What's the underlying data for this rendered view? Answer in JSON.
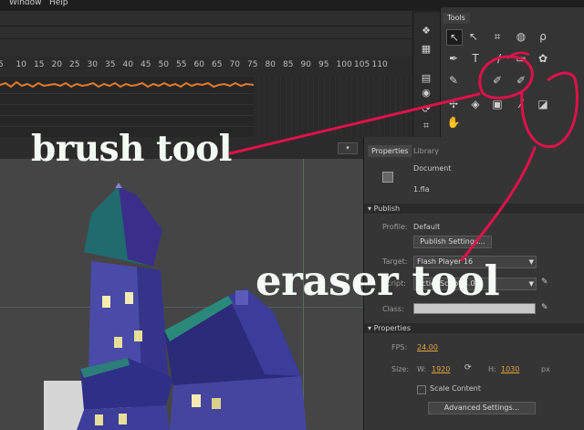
{
  "menubar": {
    "items": [
      "Window",
      "Help"
    ]
  },
  "timeline": {
    "ruler_ticks": [
      "5",
      "10",
      "15",
      "20",
      "25",
      "30",
      "35",
      "40",
      "45",
      "50",
      "55",
      "60",
      "65",
      "70",
      "75",
      "80",
      "85",
      "90",
      "95",
      "100",
      "105",
      "110"
    ]
  },
  "tools_panel": {
    "tab_label": "Tools",
    "tools": [
      {
        "name": "selection-tool-icon",
        "glyph": "↖"
      },
      {
        "name": "subselection-tool-icon",
        "glyph": "↖"
      },
      {
        "name": "free-transform-tool-icon",
        "glyph": "⌗"
      },
      {
        "name": "3d-rotation-tool-icon",
        "glyph": "◍"
      },
      {
        "name": "lasso-tool-icon",
        "glyph": "ρ"
      },
      {
        "name": "pen-tool-icon",
        "glyph": "✒"
      },
      {
        "name": "text-tool-icon",
        "glyph": "T"
      },
      {
        "name": "line-tool-icon",
        "glyph": "/"
      },
      {
        "name": "rectangle-tool-icon",
        "glyph": "▭"
      },
      {
        "name": "deco-tool-icon",
        "glyph": "✿"
      },
      {
        "name": "pencil-tool-icon",
        "glyph": "✎"
      },
      {
        "name": "brush-tool-icon",
        "glyph": "✐"
      },
      {
        "name": "paint-brush-tool-icon",
        "glyph": "✐"
      },
      {
        "name": "bone-tool-icon",
        "glyph": "✢"
      },
      {
        "name": "paint-bucket-tool-icon",
        "glyph": "◈"
      },
      {
        "name": "ink-bottle-tool-icon",
        "glyph": "▣"
      },
      {
        "name": "eyedropper-tool-icon",
        "glyph": "⁄"
      },
      {
        "name": "eraser-tool-icon",
        "glyph": "◪"
      },
      {
        "name": "hand-tool-icon",
        "glyph": "✋"
      }
    ]
  },
  "properties_panel": {
    "tabs": [
      "Properties",
      "Library"
    ],
    "document_label": "Document",
    "document_name": "1.fla",
    "publish": {
      "section_label": "Publish",
      "profile_label": "Profile:",
      "profile_value": "Default",
      "settings_button": "Publish Settings...",
      "target_label": "Target:",
      "target_value": "Flash Player 16",
      "script_label": "Script:",
      "script_value": "ActionScript 3.0",
      "class_label": "Class:",
      "class_value": ""
    },
    "properties": {
      "section_label": "Properties",
      "fps_label": "FPS:",
      "fps_value": "24.00",
      "size_label": "Size:",
      "w_label": "W:",
      "w_value": "1920",
      "h_label": "H:",
      "h_value": "1030",
      "unit": "px",
      "scale_content_label": "Scale Content",
      "advanced_button": "Advanced Settings..."
    }
  },
  "annotations": {
    "brush": "brush tool",
    "eraser": "eraser tool",
    "color": "#e0114a"
  }
}
